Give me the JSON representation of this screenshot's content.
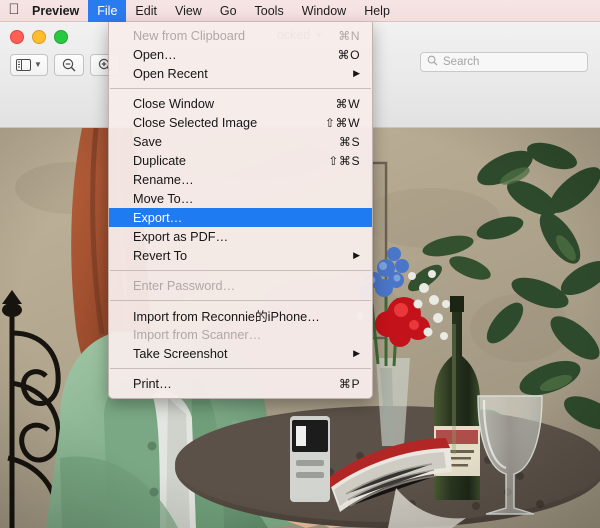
{
  "menubar": {
    "apple_icon": "apple-logo",
    "items": [
      {
        "label": "Preview",
        "bold": true,
        "active": false
      },
      {
        "label": "File",
        "bold": false,
        "active": true
      },
      {
        "label": "Edit",
        "bold": false,
        "active": false
      },
      {
        "label": "View",
        "bold": false,
        "active": false
      },
      {
        "label": "Go",
        "bold": false,
        "active": false
      },
      {
        "label": "Tools",
        "bold": false,
        "active": false
      },
      {
        "label": "Window",
        "bold": false,
        "active": false
      },
      {
        "label": "Help",
        "bold": false,
        "active": false
      }
    ]
  },
  "window": {
    "title": "ocked",
    "title_chevron": "chevron-down-icon",
    "traffic_lights": {
      "close": "#ff5f57",
      "minimize": "#febc2e",
      "zoom": "#28c840"
    },
    "toolbar": {
      "sidebar_button": "sidebar-icon",
      "sidebar_chevron": "chevron-down-icon",
      "zoom_out_button": "zoom-out-icon",
      "zoom_in_button": "zoom-in-icon"
    },
    "search": {
      "icon": "search-icon",
      "placeholder": "Search",
      "value": ""
    }
  },
  "file_menu": {
    "open": true,
    "highlight_color": "#1f7bf2",
    "groups": [
      {
        "items": [
          {
            "label": "New from Clipboard",
            "shortcut": "⌘N",
            "disabled": true,
            "selected": false,
            "submenu": false
          },
          {
            "label": "Open…",
            "shortcut": "⌘O",
            "disabled": false,
            "selected": false,
            "submenu": false
          },
          {
            "label": "Open Recent",
            "shortcut": "",
            "disabled": false,
            "selected": false,
            "submenu": true
          }
        ]
      },
      {
        "items": [
          {
            "label": "Close Window",
            "shortcut": "⌘W",
            "disabled": false,
            "selected": false,
            "submenu": false
          },
          {
            "label": "Close Selected Image",
            "shortcut": "⇧⌘W",
            "disabled": false,
            "selected": false,
            "submenu": false
          },
          {
            "label": "Save",
            "shortcut": "⌘S",
            "disabled": false,
            "selected": false,
            "submenu": false
          },
          {
            "label": "Duplicate",
            "shortcut": "⇧⌘S",
            "disabled": false,
            "selected": false,
            "submenu": false
          },
          {
            "label": "Rename…",
            "shortcut": "",
            "disabled": false,
            "selected": false,
            "submenu": false
          },
          {
            "label": "Move To…",
            "shortcut": "",
            "disabled": false,
            "selected": false,
            "submenu": false
          },
          {
            "label": "Export…",
            "shortcut": "",
            "disabled": false,
            "selected": true,
            "submenu": false
          },
          {
            "label": "Export as PDF…",
            "shortcut": "",
            "disabled": false,
            "selected": false,
            "submenu": false
          },
          {
            "label": "Revert To",
            "shortcut": "",
            "disabled": false,
            "selected": false,
            "submenu": true
          }
        ]
      },
      {
        "items": [
          {
            "label": "Enter Password…",
            "shortcut": "",
            "disabled": true,
            "selected": false,
            "submenu": false
          }
        ]
      },
      {
        "items": [
          {
            "label": "Import from Reconnie的iPhone…",
            "shortcut": "",
            "disabled": false,
            "selected": false,
            "submenu": false
          },
          {
            "label": "Import from Scanner…",
            "shortcut": "",
            "disabled": true,
            "selected": false,
            "submenu": false
          },
          {
            "label": "Take Screenshot",
            "shortcut": "",
            "disabled": false,
            "selected": false,
            "submenu": true
          }
        ]
      },
      {
        "items": [
          {
            "label": "Print…",
            "shortcut": "⌘P",
            "disabled": false,
            "selected": false,
            "submenu": false
          }
        ]
      }
    ]
  },
  "photo": {
    "description": "Woman with auburn hair in a green jacket reading a magazine at an outdoor patio table",
    "wall_color": "#b4a890",
    "jacket_color": "#8cb694",
    "hair_color": "#a9522c",
    "foliage_color": "#2f4a2c",
    "bottle_color": "#2e3a22",
    "rose_color": "#c4121a",
    "blue_flower_color": "#4a76c8"
  }
}
